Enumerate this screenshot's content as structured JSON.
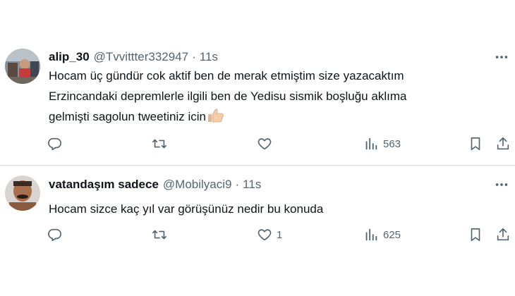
{
  "tweets": [
    {
      "display_name": "alip_30",
      "handle": "@Tvvittter332947",
      "separator": "·",
      "time": "11s",
      "text_lines": [
        "Hocam üç gündür cok aktif ben de merak etmiştim size yazacaktım",
        "Erzincandaki depremlerle ilgili ben de Yedisu sismik boşluğu  aklıma",
        "gelmişti sagolun tweetiniz icin"
      ],
      "emoji": "thumbs-up",
      "replies": "",
      "retweets": "",
      "likes": "",
      "views": "563"
    },
    {
      "display_name": "vatandaşım sadece",
      "handle": "@Mobilyaci9",
      "separator": "·",
      "time": "11s",
      "text_lines": [
        "Hocam sizce kaç yıl var görüşünüz nedir bu konuda"
      ],
      "replies": "",
      "retweets": "",
      "likes": "1",
      "views": "625"
    }
  ],
  "icons": {
    "reply": "reply-icon",
    "retweet": "retweet-icon",
    "like": "heart-icon",
    "views": "views-icon",
    "bookmark": "bookmark-icon",
    "share": "share-icon",
    "more": "more-icon"
  },
  "colors": {
    "text": "#0f1419",
    "secondary": "#536471",
    "divider": "#d9dee2"
  }
}
